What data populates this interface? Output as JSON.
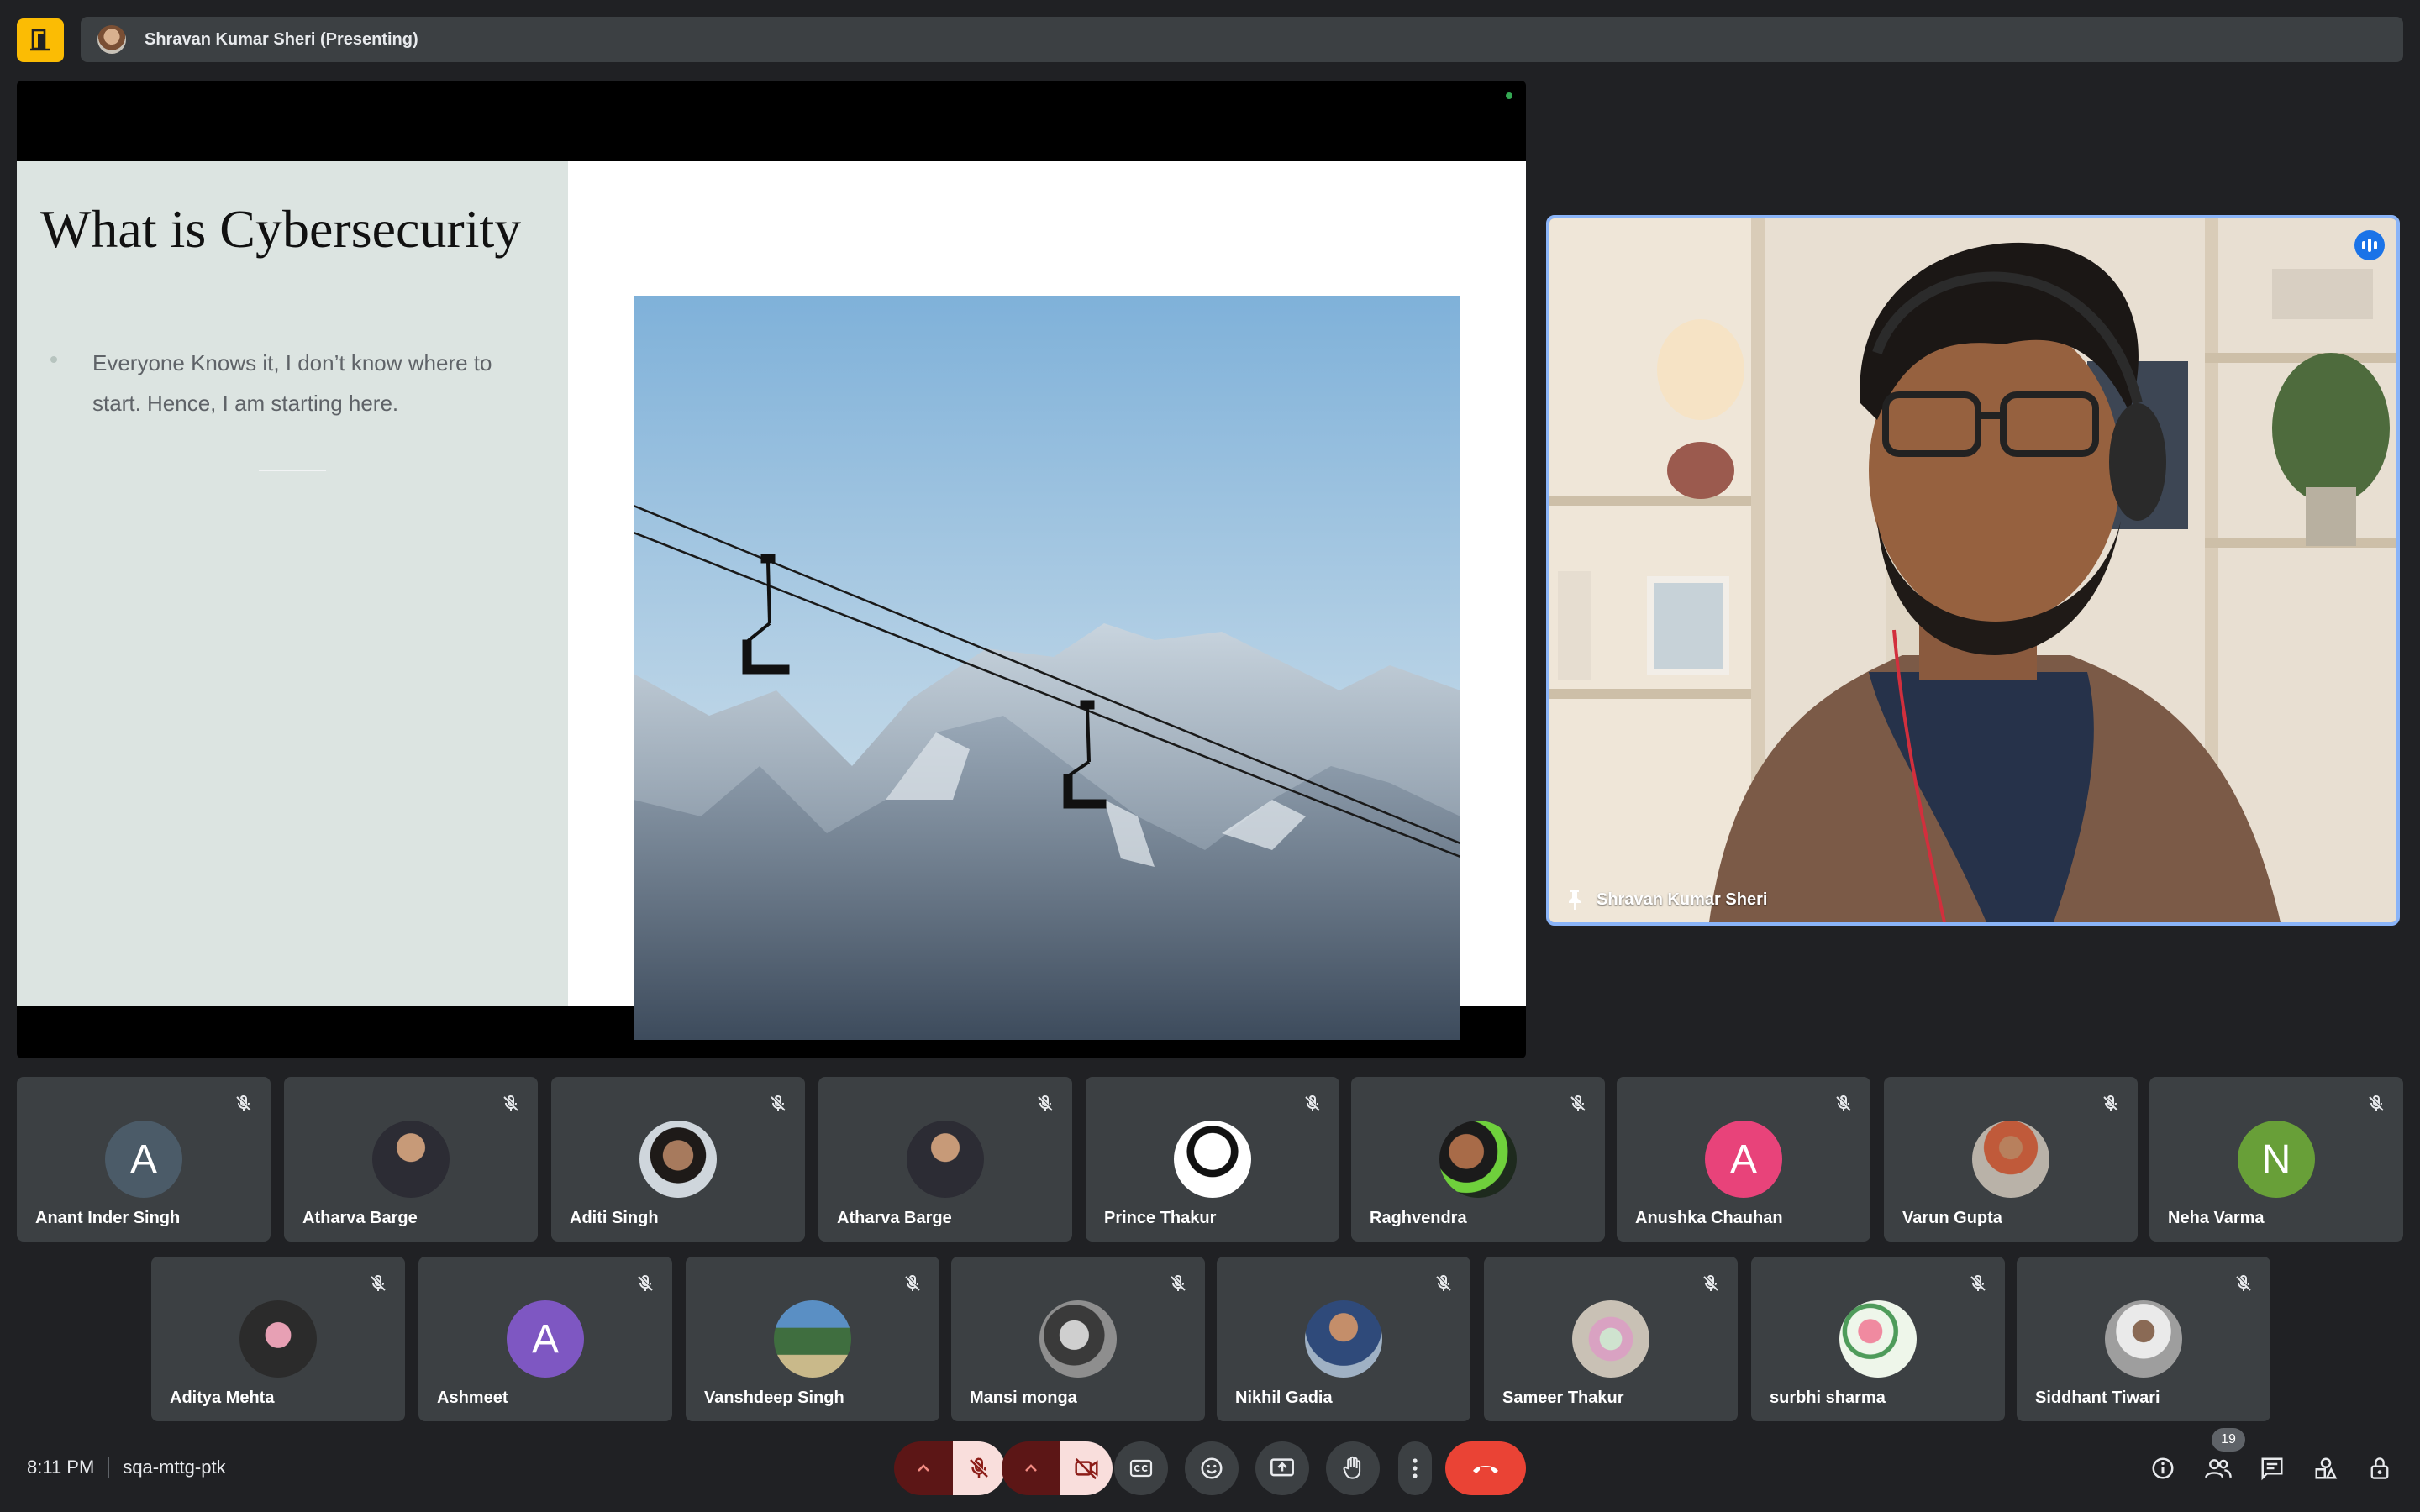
{
  "topbar": {
    "presenting_text": "Shravan Kumar Sheri (Presenting)",
    "logo_icon": "door-exit-icon",
    "accent": "#fbbc04"
  },
  "presentation": {
    "slide_title": "What is Cybersecurity",
    "bullet": "Everyone Knows it, I don’t know where to start. Hence, I am starting here.",
    "image_alt": "mountain-chairlift-photo"
  },
  "speaker": {
    "name": "Shravan Kumar Sheri",
    "pin_icon": "pin-icon",
    "speaking_icon": "speaking-indicator-icon",
    "highlight": "#8ab4f8"
  },
  "participants_row1": [
    {
      "name": "Anant Inder Singh",
      "initial": "A",
      "color": "#4b5b68"
    },
    {
      "name": "Atharva Barge",
      "initial": "",
      "color": "#9aa0a6"
    },
    {
      "name": "Aditi Singh",
      "initial": "",
      "color": "#c4a78e"
    },
    {
      "name": "Atharva Barge",
      "initial": "",
      "color": "#9aa0a6"
    },
    {
      "name": "Prince Thakur",
      "initial": "",
      "color": "#ffffff"
    },
    {
      "name": "Raghvendra",
      "initial": "",
      "color": "#2e7d32"
    },
    {
      "name": "Anushka Chauhan",
      "initial": "A",
      "color": "#e8437a"
    },
    {
      "name": "Varun Gupta",
      "initial": "",
      "color": "#b0a89c"
    },
    {
      "name": "Neha Varma",
      "initial": "N",
      "color": "#689f38"
    }
  ],
  "participants_row2": [
    {
      "name": "Aditya Mehta",
      "initial": "",
      "color": "#2b2b2b"
    },
    {
      "name": "Ashmeet",
      "initial": "A",
      "color": "#7e57c2"
    },
    {
      "name": "Vanshdeep Singh",
      "initial": "",
      "color": "#5b8a5f"
    },
    {
      "name": "Mansi monga",
      "initial": "",
      "color": "#707070"
    },
    {
      "name": "Nikhil Gadia",
      "initial": "",
      "color": "#3d5a80"
    },
    {
      "name": "Sameer Thakur",
      "initial": "",
      "color": "#d8c8b8"
    },
    {
      "name": "surbhi sharma",
      "initial": "",
      "color": "#e9f3e5"
    },
    {
      "name": "Siddhant Tiwari",
      "initial": "",
      "color": "#bcbcbc"
    }
  ],
  "bottom": {
    "time": "8:11 PM",
    "meeting_code": "sqa-mttg-ptk",
    "participant_count": "19",
    "controls": [
      "mic-off-icon",
      "camera-off-icon",
      "captions-icon",
      "emoji-icon",
      "present-screen-icon",
      "raise-hand-icon",
      "more-options-icon",
      "hang-up-icon"
    ],
    "right_icons": [
      "info-icon",
      "people-icon",
      "chat-icon",
      "activities-icon",
      "host-controls-icon"
    ]
  }
}
